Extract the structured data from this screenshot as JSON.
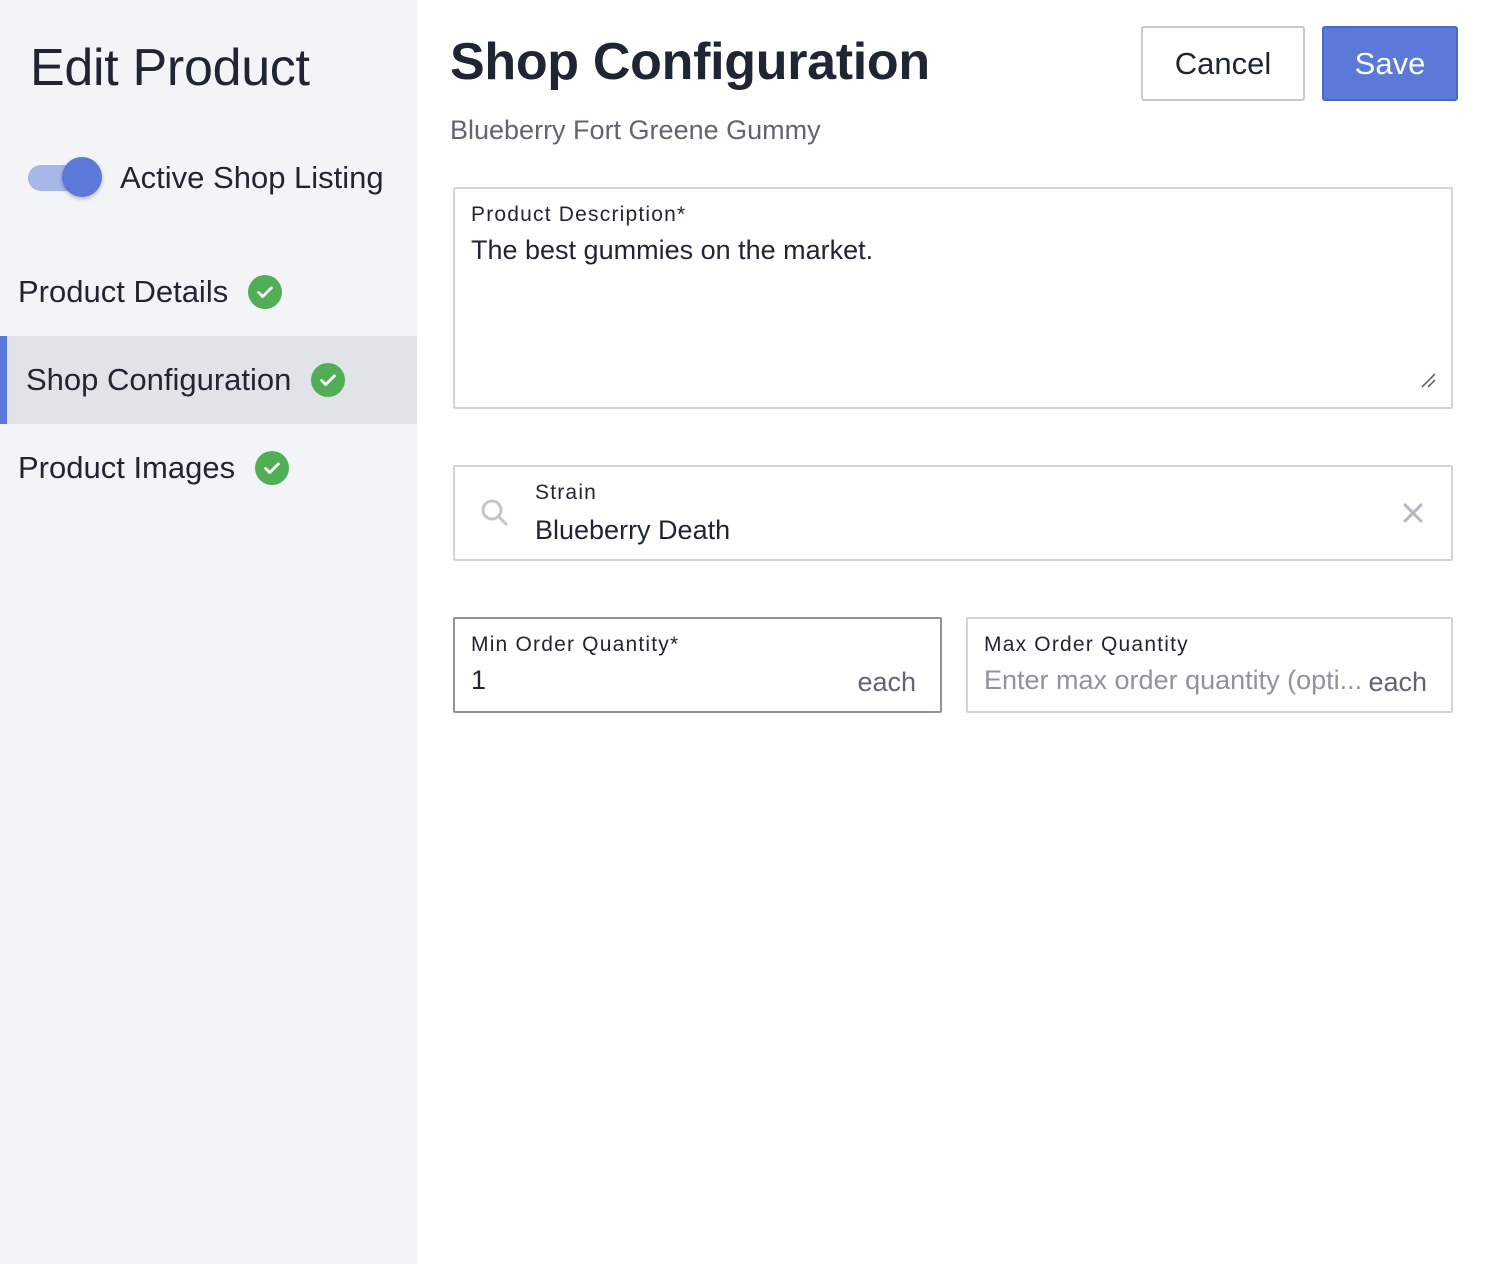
{
  "sidebar": {
    "title": "Edit Product",
    "toggle": {
      "label": "Active Shop Listing",
      "on": true
    },
    "nav": [
      {
        "label": "Product Details",
        "complete": true,
        "active": false
      },
      {
        "label": "Shop Configuration",
        "complete": true,
        "active": true
      },
      {
        "label": "Product Images",
        "complete": true,
        "active": false
      }
    ]
  },
  "header": {
    "title": "Shop Configuration",
    "subtitle": "Blueberry Fort Greene Gummy",
    "cancel_label": "Cancel",
    "save_label": "Save"
  },
  "form": {
    "description": {
      "label": "Product Description*",
      "value": "The best gummies on the market."
    },
    "strain": {
      "label": "Strain",
      "value": "Blueberry Death"
    },
    "min_qty": {
      "label": "Min Order Quantity*",
      "value": "1",
      "unit": "each"
    },
    "max_qty": {
      "label": "Max Order Quantity",
      "value": "",
      "placeholder": "Enter max order quantity (opti...",
      "unit": "each"
    }
  },
  "colors": {
    "accent": "#5b79d8",
    "success": "#52ad57",
    "sidebar_bg": "#f3f4f8"
  }
}
